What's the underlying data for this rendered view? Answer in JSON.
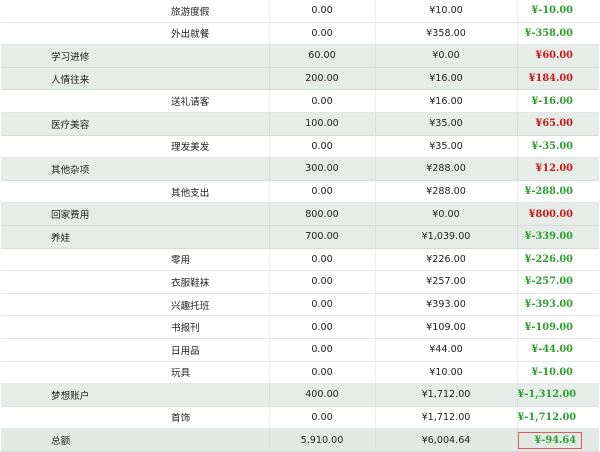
{
  "rows": [
    {
      "kind": "sub",
      "category": "",
      "subcategory": "旅游度假",
      "budget": "0.00",
      "actual": "¥10.00",
      "balance": "¥-10.00",
      "sign": "neg"
    },
    {
      "kind": "sub",
      "category": "",
      "subcategory": "外出就餐",
      "budget": "0.00",
      "actual": "¥358.00",
      "balance": "¥-358.00",
      "sign": "neg"
    },
    {
      "kind": "cat",
      "category": "学习进修",
      "subcategory": "",
      "budget": "60.00",
      "actual": "¥0.00",
      "balance": "¥60.00",
      "sign": "pos"
    },
    {
      "kind": "cat",
      "category": "人情往来",
      "subcategory": "",
      "budget": "200.00",
      "actual": "¥16.00",
      "balance": "¥184.00",
      "sign": "pos"
    },
    {
      "kind": "sub",
      "category": "",
      "subcategory": "送礼请客",
      "budget": "0.00",
      "actual": "¥16.00",
      "balance": "¥-16.00",
      "sign": "neg"
    },
    {
      "kind": "cat",
      "category": "医疗美容",
      "subcategory": "",
      "budget": "100.00",
      "actual": "¥35.00",
      "balance": "¥65.00",
      "sign": "pos"
    },
    {
      "kind": "sub",
      "category": "",
      "subcategory": "理发美发",
      "budget": "0.00",
      "actual": "¥35.00",
      "balance": "¥-35.00",
      "sign": "neg"
    },
    {
      "kind": "cat",
      "category": "其他杂项",
      "subcategory": "",
      "budget": "300.00",
      "actual": "¥288.00",
      "balance": "¥12.00",
      "sign": "pos"
    },
    {
      "kind": "sub",
      "category": "",
      "subcategory": "其他支出",
      "budget": "0.00",
      "actual": "¥288.00",
      "balance": "¥-288.00",
      "sign": "neg"
    },
    {
      "kind": "cat",
      "category": "回家费用",
      "subcategory": "",
      "budget": "800.00",
      "actual": "¥0.00",
      "balance": "¥800.00",
      "sign": "pos"
    },
    {
      "kind": "cat",
      "category": "养娃",
      "subcategory": "",
      "budget": "700.00",
      "actual": "¥1,039.00",
      "balance": "¥-339.00",
      "sign": "neg"
    },
    {
      "kind": "sub",
      "category": "",
      "subcategory": "零用",
      "budget": "0.00",
      "actual": "¥226.00",
      "balance": "¥-226.00",
      "sign": "neg"
    },
    {
      "kind": "sub",
      "category": "",
      "subcategory": "衣服鞋袜",
      "budget": "0.00",
      "actual": "¥257.00",
      "balance": "¥-257.00",
      "sign": "neg"
    },
    {
      "kind": "sub",
      "category": "",
      "subcategory": "兴趣托班",
      "budget": "0.00",
      "actual": "¥393.00",
      "balance": "¥-393.00",
      "sign": "neg"
    },
    {
      "kind": "sub",
      "category": "",
      "subcategory": "书报刊",
      "budget": "0.00",
      "actual": "¥109.00",
      "balance": "¥-109.00",
      "sign": "neg"
    },
    {
      "kind": "sub",
      "category": "",
      "subcategory": "日用品",
      "budget": "0.00",
      "actual": "¥44.00",
      "balance": "¥-44.00",
      "sign": "neg"
    },
    {
      "kind": "sub",
      "category": "",
      "subcategory": "玩具",
      "budget": "0.00",
      "actual": "¥10.00",
      "balance": "¥-10.00",
      "sign": "neg"
    },
    {
      "kind": "cat",
      "category": "梦想账户",
      "subcategory": "",
      "budget": "400.00",
      "actual": "¥1,712.00",
      "balance": "¥-1,312.00",
      "sign": "neg"
    },
    {
      "kind": "sub",
      "category": "",
      "subcategory": "首饰",
      "budget": "0.00",
      "actual": "¥1,712.00",
      "balance": "¥-1,712.00",
      "sign": "neg"
    }
  ],
  "total": {
    "label": "总额",
    "budget": "5,910.00",
    "actual": "¥6,004.64",
    "balance": "¥-94.64",
    "sign": "neg"
  },
  "colors": {
    "negative": "#2e9e2e",
    "positive": "#c21818",
    "category_row_bg": "#e6ede9",
    "total_highlight_border": "#e05a5a"
  }
}
